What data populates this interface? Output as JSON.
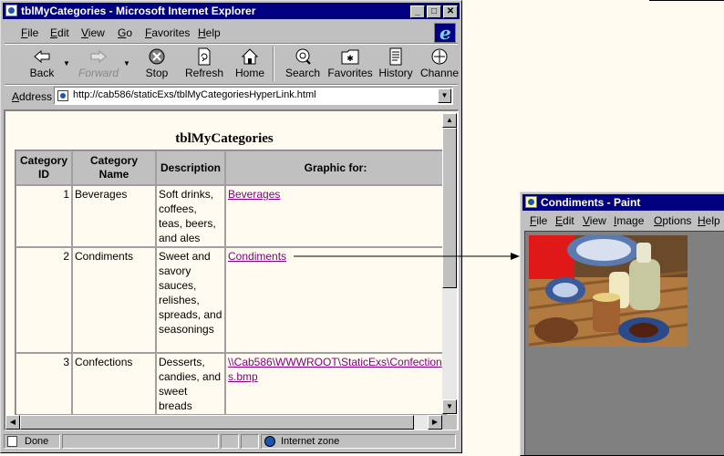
{
  "ie": {
    "title": "tblMyCategories - Microsoft Internet Explorer",
    "menu": [
      "File",
      "Edit",
      "View",
      "Go",
      "Favorites",
      "Help"
    ],
    "toolbar": {
      "back": "Back",
      "forward": "Forward",
      "stop": "Stop",
      "refresh": "Refresh",
      "home": "Home",
      "search": "Search",
      "favorites": "Favorites",
      "history": "History",
      "channels": "Channe"
    },
    "address_label": "Address",
    "address_value": "http://cab586/staticExs/tblMyCategoriesHyperLink.html",
    "status_text": "Done",
    "zone_text": "Internet zone"
  },
  "doc": {
    "title": "tblMyCategories",
    "columns": [
      "Category ID",
      "Category Name",
      "Description",
      "Graphic for:"
    ],
    "rows": [
      {
        "id": "1",
        "name": "Beverages",
        "description": "Soft drinks, coffees, teas, beers, and ales",
        "link": "Beverages"
      },
      {
        "id": "2",
        "name": "Condiments",
        "description": "Sweet and savory sauces, relishes, spreads, and seasonings",
        "link": "Condiments"
      },
      {
        "id": "3",
        "name": "Confections",
        "description": "Desserts, candies, and sweet breads",
        "link": "\\\\Cab586\\WWWROOT\\StaticExs\\Confections.bmp"
      }
    ]
  },
  "paint": {
    "title": "Condiments - Paint",
    "menu": [
      "File",
      "Edit",
      "View",
      "Image",
      "Options",
      "Help"
    ]
  },
  "colors": {
    "titlebar": "#000080",
    "chrome": "#c0c0c0",
    "page_bg": "#fffbf0",
    "visited_link": "#800080"
  }
}
